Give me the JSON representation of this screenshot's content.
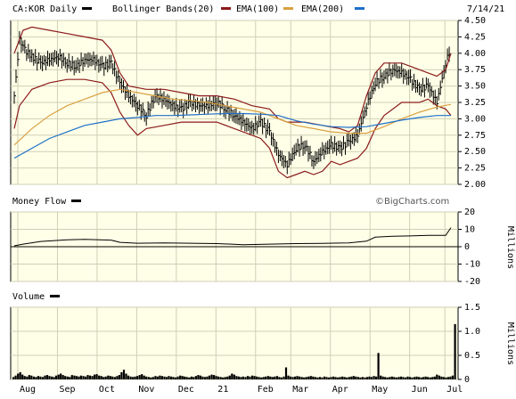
{
  "header": {
    "symbol_label": "CA:KOR Daily",
    "legend": [
      {
        "name": "Bollinger Bands(20)",
        "color": "#8b1a1a"
      },
      {
        "name": "EMA(100)",
        "color": "#d9a040"
      },
      {
        "name": "EMA(200)",
        "color": "#1e6fc8"
      }
    ],
    "date_label": "7/14/21"
  },
  "watermark": "©BigCharts.com",
  "colors": {
    "panel_bg": "#ffffe8",
    "grid": "#cfcfb5",
    "price": "#000000",
    "bollinger": "#8b1a1a",
    "ema100": "#d9a040",
    "ema200": "#1e6fc8",
    "volume": "#000000"
  },
  "panels": {
    "money_flow": {
      "title": "Money Flow",
      "unit": "Millions"
    },
    "volume": {
      "title": "Volume",
      "unit": "Millions"
    }
  },
  "chart_data": [
    {
      "type": "line",
      "panel": "price",
      "ylim": [
        2.0,
        4.5
      ],
      "yticks": [
        "4.50",
        "4.25",
        "4.00",
        "3.75",
        "3.50",
        "3.25",
        "3.00",
        "2.75",
        "2.50",
        "2.25",
        "2.00"
      ],
      "xticks": [
        "Aug",
        "Sep",
        "Oct",
        "Nov",
        "Dec",
        "21",
        "Feb",
        "Mar",
        "Apr",
        "May",
        "Jun",
        "Jul"
      ],
      "x_range_weeks": [
        0,
        50
      ],
      "series": [
        {
          "name": "CA:KOR Daily",
          "style": "ohlc",
          "points": [
            [
              0,
              3.35
            ],
            [
              0.6,
              4.2
            ],
            [
              1.2,
              4.05
            ],
            [
              2,
              3.95
            ],
            [
              3,
              3.85
            ],
            [
              4,
              3.9
            ],
            [
              5,
              3.95
            ],
            [
              6,
              3.85
            ],
            [
              7,
              3.8
            ],
            [
              8,
              3.9
            ],
            [
              9,
              3.9
            ],
            [
              10,
              3.8
            ],
            [
              11,
              3.85
            ],
            [
              12,
              3.55
            ],
            [
              13,
              3.35
            ],
            [
              14,
              3.2
            ],
            [
              15,
              3.05
            ],
            [
              16,
              3.35
            ],
            [
              17,
              3.3
            ],
            [
              18,
              3.2
            ],
            [
              19,
              3.15
            ],
            [
              20,
              3.25
            ],
            [
              21,
              3.2
            ],
            [
              22,
              3.2
            ],
            [
              23,
              3.25
            ],
            [
              24,
              3.15
            ],
            [
              25,
              3.05
            ],
            [
              26,
              2.95
            ],
            [
              27,
              2.85
            ],
            [
              28,
              2.95
            ],
            [
              29,
              2.8
            ],
            [
              30,
              2.45
            ],
            [
              31,
              2.3
            ],
            [
              32,
              2.55
            ],
            [
              33,
              2.6
            ],
            [
              34,
              2.35
            ],
            [
              35,
              2.5
            ],
            [
              36,
              2.6
            ],
            [
              37,
              2.55
            ],
            [
              38,
              2.65
            ],
            [
              39,
              2.75
            ],
            [
              40,
              3.2
            ],
            [
              41,
              3.55
            ],
            [
              42,
              3.65
            ],
            [
              43,
              3.75
            ],
            [
              44,
              3.7
            ],
            [
              45,
              3.6
            ],
            [
              46,
              3.45
            ],
            [
              47,
              3.5
            ],
            [
              48,
              3.25
            ],
            [
              49,
              3.85
            ],
            [
              49.6,
              4.1
            ]
          ]
        },
        {
          "name": "Bollinger Bands(20) upper",
          "points": [
            [
              0,
              4.0
            ],
            [
              1,
              4.35
            ],
            [
              2,
              4.4
            ],
            [
              4,
              4.35
            ],
            [
              6,
              4.3
            ],
            [
              8,
              4.25
            ],
            [
              10,
              4.2
            ],
            [
              11,
              4.05
            ],
            [
              12,
              3.7
            ],
            [
              13,
              3.5
            ],
            [
              15,
              3.45
            ],
            [
              17,
              3.45
            ],
            [
              19,
              3.4
            ],
            [
              21,
              3.35
            ],
            [
              23,
              3.35
            ],
            [
              25,
              3.3
            ],
            [
              27,
              3.2
            ],
            [
              29,
              3.15
            ],
            [
              30,
              3.0
            ],
            [
              31,
              2.95
            ],
            [
              33,
              2.95
            ],
            [
              35,
              2.9
            ],
            [
              37,
              2.85
            ],
            [
              38,
              2.8
            ],
            [
              39,
              2.9
            ],
            [
              40,
              3.35
            ],
            [
              41,
              3.7
            ],
            [
              42,
              3.85
            ],
            [
              44,
              3.85
            ],
            [
              46,
              3.75
            ],
            [
              47,
              3.7
            ],
            [
              48,
              3.65
            ],
            [
              49,
              3.75
            ],
            [
              49.6,
              4.0
            ]
          ]
        },
        {
          "name": "Bollinger Bands(20) lower",
          "points": [
            [
              0,
              2.85
            ],
            [
              0.6,
              3.2
            ],
            [
              2,
              3.45
            ],
            [
              4,
              3.55
            ],
            [
              6,
              3.6
            ],
            [
              8,
              3.6
            ],
            [
              10,
              3.55
            ],
            [
              11,
              3.4
            ],
            [
              12,
              3.1
            ],
            [
              13,
              2.9
            ],
            [
              14,
              2.75
            ],
            [
              15,
              2.85
            ],
            [
              17,
              2.9
            ],
            [
              19,
              2.95
            ],
            [
              21,
              2.95
            ],
            [
              23,
              2.95
            ],
            [
              25,
              2.85
            ],
            [
              27,
              2.75
            ],
            [
              28,
              2.7
            ],
            [
              29,
              2.55
            ],
            [
              30,
              2.2
            ],
            [
              31,
              2.1
            ],
            [
              32,
              2.15
            ],
            [
              33,
              2.2
            ],
            [
              34,
              2.15
            ],
            [
              35,
              2.2
            ],
            [
              36,
              2.35
            ],
            [
              37,
              2.3
            ],
            [
              38,
              2.35
            ],
            [
              39,
              2.4
            ],
            [
              40,
              2.55
            ],
            [
              41,
              2.85
            ],
            [
              42,
              3.05
            ],
            [
              44,
              3.25
            ],
            [
              46,
              3.25
            ],
            [
              47,
              3.3
            ],
            [
              48,
              3.2
            ],
            [
              49,
              3.15
            ],
            [
              49.6,
              3.05
            ]
          ]
        },
        {
          "name": "EMA(100)",
          "points": [
            [
              0,
              2.6
            ],
            [
              2,
              2.85
            ],
            [
              4,
              3.05
            ],
            [
              6,
              3.2
            ],
            [
              8,
              3.3
            ],
            [
              10,
              3.4
            ],
            [
              12,
              3.45
            ],
            [
              14,
              3.4
            ],
            [
              16,
              3.35
            ],
            [
              18,
              3.3
            ],
            [
              20,
              3.28
            ],
            [
              22,
              3.25
            ],
            [
              24,
              3.2
            ],
            [
              26,
              3.15
            ],
            [
              28,
              3.1
            ],
            [
              30,
              3.0
            ],
            [
              32,
              2.9
            ],
            [
              34,
              2.85
            ],
            [
              36,
              2.8
            ],
            [
              38,
              2.78
            ],
            [
              40,
              2.78
            ],
            [
              42,
              2.88
            ],
            [
              44,
              3.0
            ],
            [
              46,
              3.1
            ],
            [
              48,
              3.18
            ],
            [
              49.6,
              3.22
            ]
          ]
        },
        {
          "name": "EMA(200)",
          "points": [
            [
              0,
              2.4
            ],
            [
              2,
              2.55
            ],
            [
              4,
              2.7
            ],
            [
              6,
              2.8
            ],
            [
              8,
              2.9
            ],
            [
              10,
              2.95
            ],
            [
              12,
              3.0
            ],
            [
              14,
              3.02
            ],
            [
              16,
              3.05
            ],
            [
              18,
              3.05
            ],
            [
              20,
              3.06
            ],
            [
              22,
              3.07
            ],
            [
              24,
              3.08
            ],
            [
              26,
              3.08
            ],
            [
              28,
              3.07
            ],
            [
              30,
              3.05
            ],
            [
              32,
              2.97
            ],
            [
              34,
              2.92
            ],
            [
              36,
              2.88
            ],
            [
              38,
              2.87
            ],
            [
              40,
              2.88
            ],
            [
              42,
              2.93
            ],
            [
              44,
              2.98
            ],
            [
              46,
              3.02
            ],
            [
              48,
              3.05
            ],
            [
              49.6,
              3.05
            ]
          ]
        }
      ]
    },
    {
      "type": "line",
      "panel": "money_flow",
      "ylim": [
        -20,
        20
      ],
      "yticks": [
        "20",
        "10",
        "0",
        "-10",
        "-20"
      ],
      "ylabel": "Millions",
      "series": [
        {
          "name": "Money Flow",
          "points": [
            [
              0,
              0.5
            ],
            [
              1,
              1.5
            ],
            [
              3,
              3
            ],
            [
              6,
              4
            ],
            [
              8,
              4.2
            ],
            [
              11,
              3.8
            ],
            [
              12,
              2.5
            ],
            [
              14,
              2
            ],
            [
              17,
              2.2
            ],
            [
              20,
              2
            ],
            [
              23,
              1.8
            ],
            [
              26,
              1.2
            ],
            [
              29,
              1.5
            ],
            [
              32,
              1.8
            ],
            [
              35,
              1.9
            ],
            [
              38,
              2.2
            ],
            [
              40,
              3.2
            ],
            [
              41,
              5.5
            ],
            [
              43,
              6
            ],
            [
              45,
              6.2
            ],
            [
              47,
              6.5
            ],
            [
              49,
              6.5
            ],
            [
              49.6,
              11
            ]
          ]
        }
      ]
    },
    {
      "type": "bar",
      "panel": "volume",
      "ylim": [
        0,
        1.5
      ],
      "yticks": [
        "1.5",
        "1.0",
        "0.5",
        "0"
      ],
      "ylabel": "Millions",
      "values": [
        0.05,
        0.08,
        0.12,
        0.15,
        0.1,
        0.07,
        0.06,
        0.09,
        0.08,
        0.06,
        0.05,
        0.07,
        0.06,
        0.05,
        0.08,
        0.09,
        0.07,
        0.06,
        0.05,
        0.08,
        0.1,
        0.12,
        0.09,
        0.07,
        0.06,
        0.05,
        0.09,
        0.08,
        0.07,
        0.06,
        0.08,
        0.07,
        0.06,
        0.09,
        0.08,
        0.07,
        0.1,
        0.11,
        0.08,
        0.07,
        0.05,
        0.06,
        0.08,
        0.07,
        0.06,
        0.05,
        0.07,
        0.09,
        0.15,
        0.2,
        0.12,
        0.08,
        0.06,
        0.05,
        0.06,
        0.07,
        0.09,
        0.11,
        0.08,
        0.06,
        0.05,
        0.04,
        0.05,
        0.07,
        0.06,
        0.08,
        0.07,
        0.06,
        0.05,
        0.07,
        0.06,
        0.05,
        0.04,
        0.06,
        0.08,
        0.07,
        0.06,
        0.05,
        0.04,
        0.06,
        0.05,
        0.07,
        0.09,
        0.08,
        0.06,
        0.05,
        0.06,
        0.08,
        0.1,
        0.09,
        0.07,
        0.06,
        0.05,
        0.04,
        0.05,
        0.06,
        0.08,
        0.12,
        0.1,
        0.07,
        0.06,
        0.05,
        0.06,
        0.05,
        0.07,
        0.06,
        0.08,
        0.07,
        0.06,
        0.05,
        0.04,
        0.05,
        0.06,
        0.07,
        0.06,
        0.05,
        0.06,
        0.07,
        0.05,
        0.04,
        0.06,
        0.25,
        0.08,
        0.06,
        0.05,
        0.06,
        0.07,
        0.06,
        0.05,
        0.04,
        0.05,
        0.06,
        0.07,
        0.06,
        0.05,
        0.04,
        0.05,
        0.04,
        0.06,
        0.05,
        0.04,
        0.05,
        0.06,
        0.05,
        0.04,
        0.05,
        0.06,
        0.05,
        0.04,
        0.05,
        0.06,
        0.07,
        0.06,
        0.05,
        0.04,
        0.05,
        0.04,
        0.05,
        0.06,
        0.05,
        0.07,
        0.06,
        0.55,
        0.08,
        0.06,
        0.05,
        0.04,
        0.05,
        0.06,
        0.05,
        0.04,
        0.05,
        0.06,
        0.05,
        0.04,
        0.06,
        0.05,
        0.04,
        0.05,
        0.06,
        0.05,
        0.04,
        0.05,
        0.06,
        0.05,
        0.04,
        0.05,
        0.06,
        0.1,
        0.08,
        0.06,
        0.05,
        0.04,
        0.05,
        0.06,
        0.08,
        1.15
      ]
    }
  ]
}
